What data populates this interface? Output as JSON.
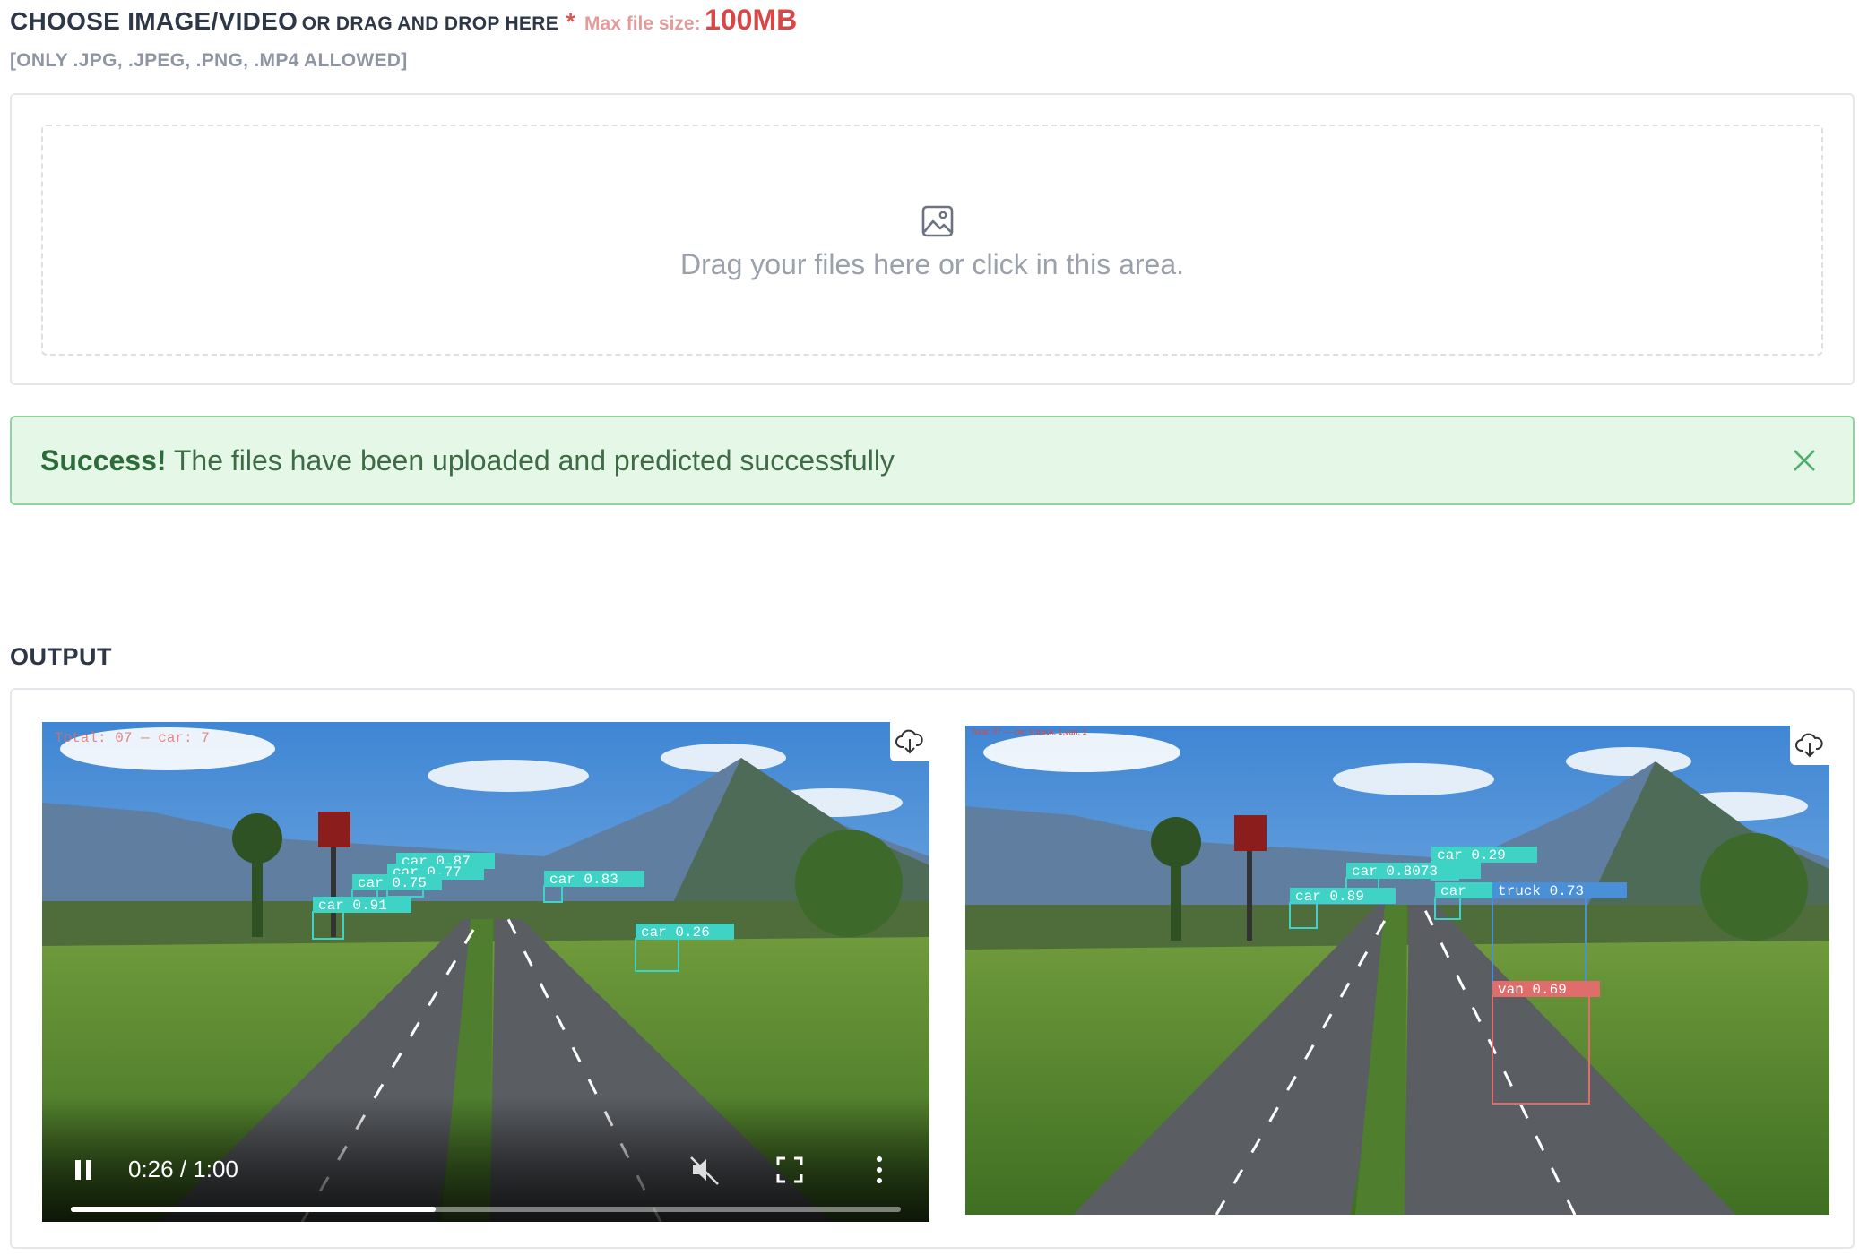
{
  "upload": {
    "title_main": "CHOOSE IMAGE/VIDEO",
    "title_sub": "OR DRAG AND DROP HERE",
    "required_mark": "*",
    "max_label": "Max file size:",
    "max_value": "100MB",
    "allowed": "[ONLY .JPG, .JPEG, .PNG, .MP4 ALLOWED]",
    "drop_text": "Drag your files here or click in this area.",
    "drop_icon": "image-icon"
  },
  "alert": {
    "strong": "Success!",
    "message": " The files have been uploaded and predicted successfully",
    "close_icon": "close-icon"
  },
  "output": {
    "title": "OUTPUT",
    "video": {
      "overlay_text": "Total: 07 — car: 7",
      "time": "0:26 / 1:00",
      "progress": 0.44,
      "download_icon": "cloud-download-icon",
      "detections": [
        {
          "label": "car 0.87"
        },
        {
          "label": "car 0.77"
        },
        {
          "label": "car 0.75"
        },
        {
          "label": "car 0.91"
        },
        {
          "label": "car 0.83"
        },
        {
          "label": "car 0.26"
        }
      ]
    },
    "image": {
      "overlay_text": "Total: 07 — car: 5;truck: 1;van: 1",
      "download_icon": "cloud-download-icon",
      "detections": [
        {
          "label": "car 0.29"
        },
        {
          "label": "car 0.8073"
        },
        {
          "label": "car 0.89"
        },
        {
          "label": "car"
        },
        {
          "label": "truck 0.73"
        },
        {
          "label": "van 0.69"
        }
      ]
    }
  },
  "colors": {
    "success_bg": "#e5f8e7",
    "success_border": "#8fd49a",
    "accent_red": "#d84747",
    "car_box": "#3fd3c6",
    "truck_box": "#4a90d9",
    "van_box": "#e06c6c"
  }
}
